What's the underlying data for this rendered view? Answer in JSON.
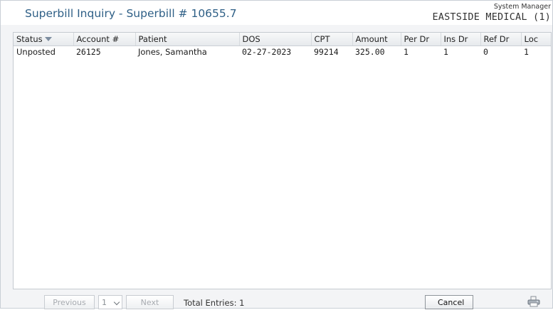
{
  "header": {
    "title": "Superbill Inquiry - Superbill # 10655.7",
    "user_role": "System Manager",
    "organization": "EASTSIDE MEDICAL (1)"
  },
  "table": {
    "columns": [
      "Status",
      "Account #",
      "Patient",
      "DOS",
      "CPT",
      "Amount",
      "Per Dr",
      "Ins Dr",
      "Ref Dr",
      "Loc"
    ],
    "sorted_column": "Status",
    "rows": [
      [
        "Unposted",
        "26125",
        "Jones, Samantha",
        "02-27-2023",
        "99214",
        "325.00",
        "1",
        "1",
        "0",
        "1"
      ]
    ]
  },
  "footer": {
    "previous_label": "Previous",
    "page_value": "1",
    "next_label": "Next",
    "total_entries": "Total Entries: 1",
    "cancel_label": "Cancel",
    "print_icon": "printer-icon"
  }
}
